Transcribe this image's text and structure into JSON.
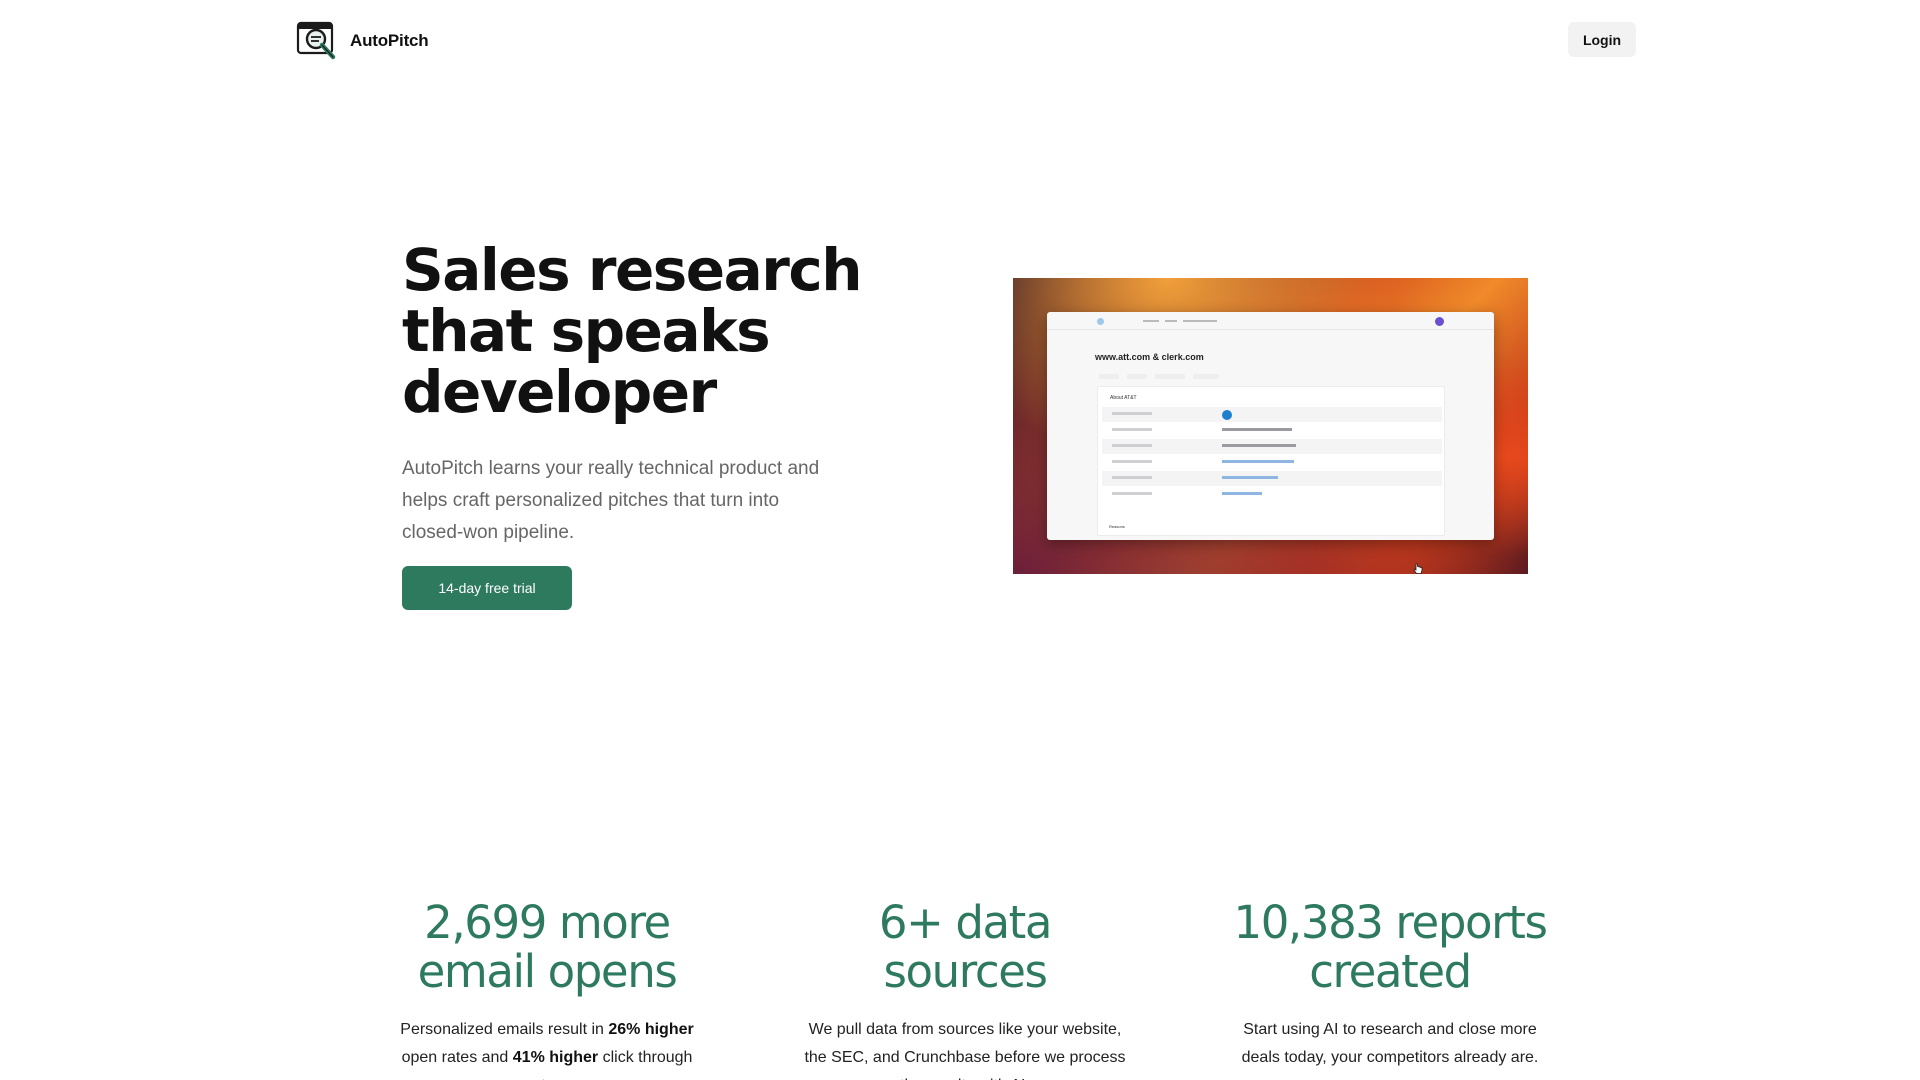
{
  "nav": {
    "brand_name": "AutoPitch",
    "login_label": "Login"
  },
  "hero": {
    "title_line1": "Sales research",
    "title_line2": "that speaks",
    "title_line3": "developer",
    "subtitle": "AutoPitch learns your really technical product and helps craft personalized pitches that turn into closed-won pipeline.",
    "cta_label": "14-day free trial"
  },
  "screenshot": {
    "title": "www.att.com & clerk.com",
    "card_title": "About AT&T",
    "footer_label": "Reasons"
  },
  "stats": [
    {
      "number_line1": "2,699 more",
      "number_line2": "email opens",
      "text_a": "Personalized emails result in ",
      "text_b": "26% higher",
      "text_c": " open rates and ",
      "text_d": "41% higher",
      "text_e": " click through rates."
    },
    {
      "number_line1": "6+ data",
      "number_line2": "sources",
      "text": "We pull data from sources like your website, the SEC, and Crunchbase before we process the results with AI."
    },
    {
      "number_line1": "10,383 reports",
      "number_line2": "created",
      "text": "Start using AI to research and close more deals today, your competitors already are."
    }
  ],
  "colors": {
    "accent": "#2e7a5f",
    "login_bg": "#f2f2f2"
  },
  "icons": {
    "logo": "magnifier-document-logo",
    "cursor": "pointer-hand-cursor"
  }
}
